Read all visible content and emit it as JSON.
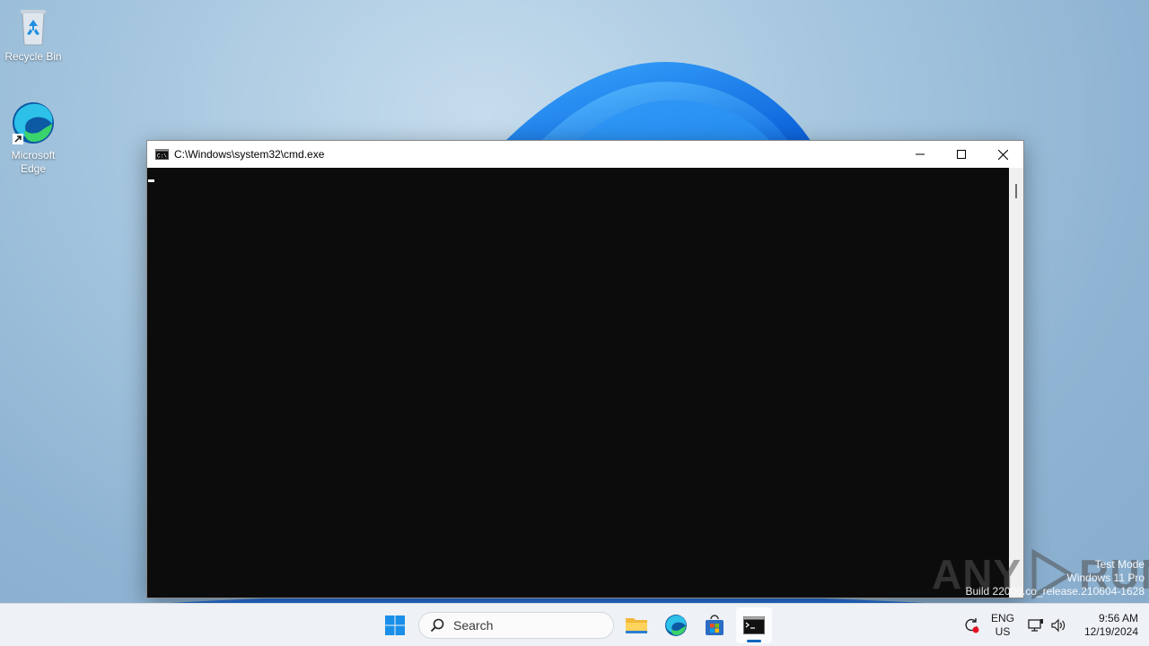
{
  "desktop": {
    "icons": [
      {
        "label": "Recycle Bin",
        "icon": "recycle-bin-icon"
      },
      {
        "label": "Microsoft Edge",
        "icon": "edge-icon"
      }
    ]
  },
  "window": {
    "title": "C:\\Windows\\system32\\cmd.exe",
    "icon": "console-icon",
    "controls": [
      "minimize-icon",
      "maximize-icon",
      "close-icon"
    ],
    "console_bg": "#0c0c0c"
  },
  "watermark": {
    "brand_left": "ANY",
    "brand_right": "RUN",
    "line1": "Test Mode",
    "line2": "Windows 11 Pro",
    "line3": "Build 22000.co_release.210604-1628"
  },
  "taskbar": {
    "search_placeholder": "Search",
    "apps": [
      "start-icon",
      "file-explorer-icon",
      "edge-icon",
      "store-icon",
      "cmd-icon"
    ],
    "active_app": "cmd-icon",
    "tray": {
      "lang_top": "ENG",
      "lang_bottom": "US",
      "time": "9:56 AM",
      "date": "12/19/2024"
    },
    "accent": "#0067c0"
  }
}
